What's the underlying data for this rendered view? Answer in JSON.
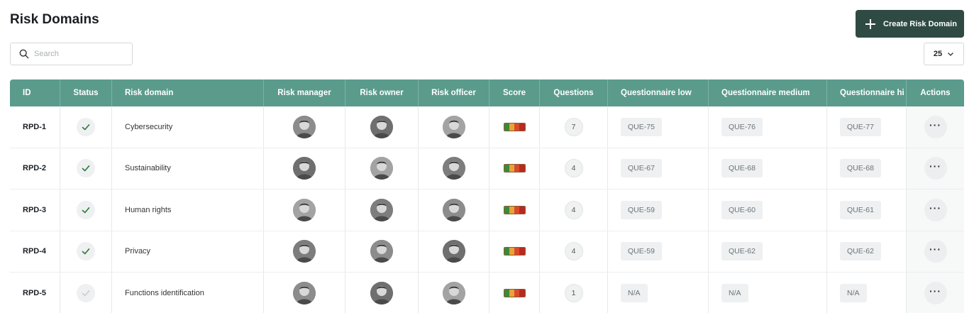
{
  "header": {
    "title": "Risk Domains",
    "create_label": "Create Risk Domain"
  },
  "search": {
    "placeholder": "Search"
  },
  "pager": {
    "page_size": "25"
  },
  "colors": {
    "header_bg": "#5a9b8c",
    "create_button_bg": "#2e4a43",
    "status_check": "#2e7a3c",
    "score": [
      "#3a8a3a",
      "#e8a23a",
      "#d94a2a",
      "#b82a20"
    ]
  },
  "table": {
    "columns": [
      "ID",
      "Status",
      "Risk domain",
      "Risk manager",
      "Risk owner",
      "Risk officer",
      "Score",
      "Questions",
      "Questionnaire low",
      "Questionnaire medium",
      "Questionnaire hi",
      "Actions"
    ],
    "rows": [
      {
        "id": "RPD-1",
        "status": "active",
        "domain": "Cybersecurity",
        "questions": "7",
        "q_low": "QUE-75",
        "q_medium": "QUE-76",
        "q_high": "QUE-77",
        "action": "···"
      },
      {
        "id": "RPD-2",
        "status": "active",
        "domain": "Sustainability",
        "questions": "4",
        "q_low": "QUE-67",
        "q_medium": "QUE-68",
        "q_high": "QUE-68",
        "action": "···"
      },
      {
        "id": "RPD-3",
        "status": "active",
        "domain": "Human rights",
        "questions": "4",
        "q_low": "QUE-59",
        "q_medium": "QUE-60",
        "q_high": "QUE-61",
        "action": "···"
      },
      {
        "id": "RPD-4",
        "status": "active",
        "domain": "Privacy",
        "questions": "4",
        "q_low": "QUE-59",
        "q_medium": "QUE-62",
        "q_high": "QUE-62",
        "action": "···"
      },
      {
        "id": "RPD-5",
        "status": "inactive",
        "domain": "Functions identification",
        "questions": "1",
        "q_low": "N/A",
        "q_medium": "N/A",
        "q_high": "N/A",
        "action": "···"
      }
    ]
  }
}
